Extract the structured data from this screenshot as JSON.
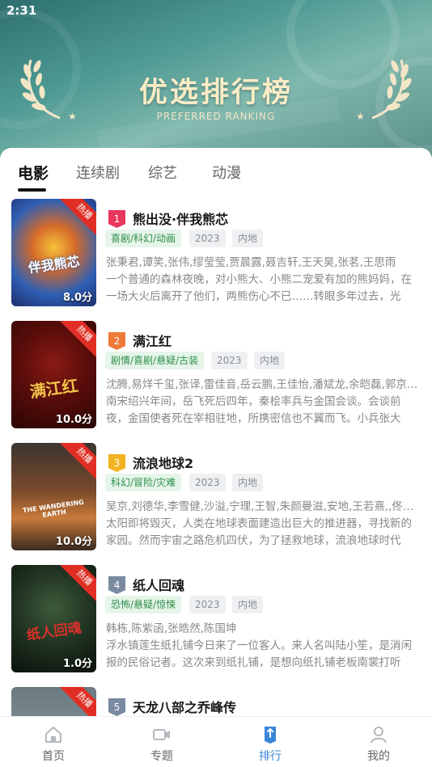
{
  "status_bar": {
    "time": "2:31"
  },
  "banner": {
    "title": "优选排行榜",
    "subtitle": "PREFERRED RANKING"
  },
  "tabs": [
    {
      "label": "电影",
      "active": true
    },
    {
      "label": "连续剧",
      "active": false
    },
    {
      "label": "综艺",
      "active": false
    },
    {
      "label": "动漫",
      "active": false
    }
  ],
  "movies": [
    {
      "rank": "1",
      "title": "熊出没·伴我熊芯",
      "genre": "喜剧/科幻/动画",
      "year": "2023",
      "region": "内地",
      "cast": "张秉君,谭笑,张伟,缪莹莹,贾晨露,聂吉轩,王天昊,张茗,王思雨",
      "desc": "一个普通的森林夜晚，对小熊大、小熊二宠爱有加的熊妈妈，在一场大火后离开了他们，两熊伤心不已……转眼多年过去，光头...",
      "badge": "热播",
      "score": "8.0分",
      "poster_text": "伴我熊芯",
      "rank_color": "#e8365d"
    },
    {
      "rank": "2",
      "title": "满江红",
      "genre": "剧情/喜剧/悬疑/古装",
      "year": "2023",
      "region": "内地",
      "cast": "沈腾,易烊千玺,张译,雷佳音,岳云鹏,王佳怡,潘斌龙,余皑磊,郭京飞,...",
      "desc": "南宋绍兴年间，岳飞死后四年，秦桧率兵与金国会谈。会谈前夜，金国使者死在宰相驻地，所携密信也不翼而飞。小兵张大（...",
      "badge": "热播",
      "score": "10.0分",
      "poster_text": "满江红",
      "rank_color": "#f07a3a"
    },
    {
      "rank": "3",
      "title": "流浪地球2",
      "genre": "科幻/冒险/灾难",
      "year": "2023",
      "region": "内地",
      "cast": "吴京,刘德华,李雪健,沙溢,宁理,王智,朱颜曼滋,安地,王若熹,,佟丽...",
      "desc": "太阳即将毁灭，人类在地球表面建造出巨大的推进器，寻找新的家园。然而宇宙之路危机四伏，为了拯救地球，流浪地球时代的...",
      "badge": "热播",
      "score": "10.0分",
      "poster_text": "THE WANDERING EARTH",
      "rank_color": "#f2b322"
    },
    {
      "rank": "4",
      "title": "纸人回魂",
      "genre": "恐怖/悬疑/惊悚",
      "year": "2023",
      "region": "内地",
      "cast": "韩栋,陈紫函,张皓然,陈国坤",
      "desc": "浮水镇莲生纸扎铺今日来了一位客人。来人名叫陆小笙，是消闲报的民俗记者。这次来到纸扎铺，是想向纸扎铺老板南裳打听一...",
      "badge": "热播",
      "score": "1.0分",
      "poster_text": "纸人回魂",
      "rank_color": "#7a8aa0"
    },
    {
      "rank": "5",
      "title": "天龙八部之乔峰传",
      "genre": "",
      "year": "",
      "region": "",
      "cast": "",
      "desc": "",
      "badge": "热播",
      "score": "",
      "poster_text": "",
      "rank_color": "#7a8aa0"
    }
  ],
  "bottom_nav": [
    {
      "label": "首页",
      "icon": "home-icon",
      "active": false
    },
    {
      "label": "专题",
      "icon": "video-camera-icon",
      "active": false
    },
    {
      "label": "排行",
      "icon": "ranking-icon",
      "active": true
    },
    {
      "label": "我的",
      "icon": "person-icon",
      "active": false
    }
  ],
  "colors": {
    "accent": "#3a86d8",
    "hot_badge": "#e02e24",
    "genre_tag": "#2e8f4a"
  }
}
